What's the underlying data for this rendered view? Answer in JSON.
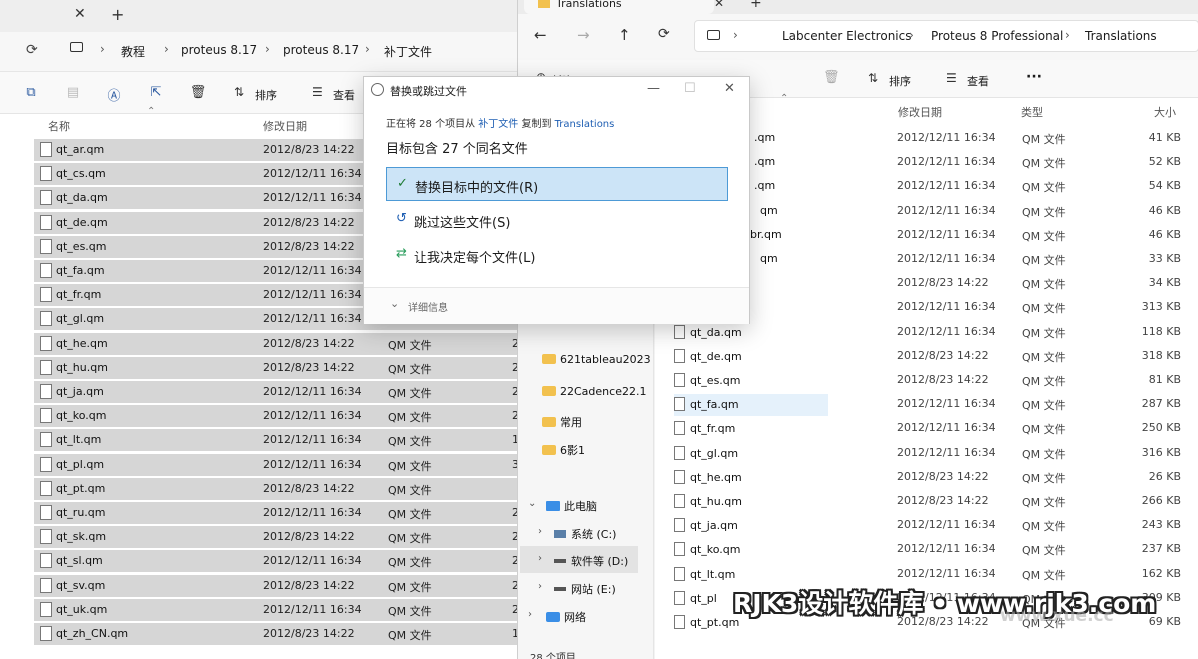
{
  "left": {
    "breadcrumbs": [
      "教程",
      "proteus 8.17",
      "proteus 8.17",
      "补丁文件"
    ],
    "toolbar": {
      "sort_label": "排序",
      "view_label": "查看"
    },
    "columns": {
      "name": "名称",
      "date": "修改日期"
    },
    "rows": [
      {
        "name": "qt_ar.qm",
        "date": "2012/8/23 14:22",
        "type": "",
        "size": ""
      },
      {
        "name": "qt_cs.qm",
        "date": "2012/12/11 16:34",
        "type": "",
        "size": ""
      },
      {
        "name": "qt_da.qm",
        "date": "2012/12/11 16:34",
        "type": "",
        "size": ""
      },
      {
        "name": "qt_de.qm",
        "date": "2012/8/23 14:22",
        "type": "",
        "size": ""
      },
      {
        "name": "qt_es.qm",
        "date": "2012/8/23 14:22",
        "type": "",
        "size": ""
      },
      {
        "name": "qt_fa.qm",
        "date": "2012/12/11 16:34",
        "type": "",
        "size": ""
      },
      {
        "name": "qt_fr.qm",
        "date": "2012/12/11 16:34",
        "type": "",
        "size": ""
      },
      {
        "name": "qt_gl.qm",
        "date": "2012/12/11 16:34",
        "type": "",
        "size": ""
      },
      {
        "name": "qt_he.qm",
        "date": "2012/8/23 14:22",
        "type": "QM 文件",
        "size": "2"
      },
      {
        "name": "qt_hu.qm",
        "date": "2012/8/23 14:22",
        "type": "QM 文件",
        "size": "2"
      },
      {
        "name": "qt_ja.qm",
        "date": "2012/12/11 16:34",
        "type": "QM 文件",
        "size": "2"
      },
      {
        "name": "qt_ko.qm",
        "date": "2012/12/11 16:34",
        "type": "QM 文件",
        "size": "2"
      },
      {
        "name": "qt_lt.qm",
        "date": "2012/12/11 16:34",
        "type": "QM 文件",
        "size": "1"
      },
      {
        "name": "qt_pl.qm",
        "date": "2012/12/11 16:34",
        "type": "QM 文件",
        "size": "3"
      },
      {
        "name": "qt_pt.qm",
        "date": "2012/8/23 14:22",
        "type": "QM 文件",
        "size": ""
      },
      {
        "name": "qt_ru.qm",
        "date": "2012/12/11 16:34",
        "type": "QM 文件",
        "size": "2"
      },
      {
        "name": "qt_sk.qm",
        "date": "2012/8/23 14:22",
        "type": "QM 文件",
        "size": "2"
      },
      {
        "name": "qt_sl.qm",
        "date": "2012/12/11 16:34",
        "type": "QM 文件",
        "size": "2"
      },
      {
        "name": "qt_sv.qm",
        "date": "2012/8/23 14:22",
        "type": "QM 文件",
        "size": "2"
      },
      {
        "name": "qt_uk.qm",
        "date": "2012/12/11 16:34",
        "type": "QM 文件",
        "size": "2"
      },
      {
        "name": "qt_zh_CN.qm",
        "date": "2012/8/23 14:22",
        "type": "QM 文件",
        "size": "1"
      }
    ]
  },
  "right": {
    "tab_title": "Translations",
    "breadcrumbs": [
      "Labcenter Electronics",
      "Proteus 8 Professional",
      "Translations"
    ],
    "toolbar": {
      "new_label": "新建",
      "sort_label": "排序",
      "view_label": "查看",
      "more_label": "···"
    },
    "columns": {
      "date": "修改日期",
      "type": "类型",
      "size": "大小"
    },
    "partial_names": [
      ".qm",
      ".qm",
      ".qm",
      "qm",
      "br.qm",
      "qm"
    ],
    "rows": [
      {
        "name": "",
        "date": "2012/12/11 16:34",
        "type": "QM 文件",
        "size": "41 KB"
      },
      {
        "name": "",
        "date": "2012/12/11 16:34",
        "type": "QM 文件",
        "size": "52 KB"
      },
      {
        "name": "",
        "date": "2012/12/11 16:34",
        "type": "QM 文件",
        "size": "54 KB"
      },
      {
        "name": "",
        "date": "2012/12/11 16:34",
        "type": "QM 文件",
        "size": "46 KB"
      },
      {
        "name": "",
        "date": "2012/12/11 16:34",
        "type": "QM 文件",
        "size": "46 KB"
      },
      {
        "name": "",
        "date": "2012/12/11 16:34",
        "type": "QM 文件",
        "size": "33 KB"
      },
      {
        "name": "",
        "date": "2012/8/23 14:22",
        "type": "QM 文件",
        "size": "34 KB"
      },
      {
        "name": "",
        "date": "2012/12/11 16:34",
        "type": "QM 文件",
        "size": "313 KB"
      },
      {
        "name": "qt_da.qm",
        "date": "2012/12/11 16:34",
        "type": "QM 文件",
        "size": "118 KB"
      },
      {
        "name": "qt_de.qm",
        "date": "2012/8/23 14:22",
        "type": "QM 文件",
        "size": "318 KB"
      },
      {
        "name": "qt_es.qm",
        "date": "2012/8/23 14:22",
        "type": "QM 文件",
        "size": "81 KB"
      },
      {
        "name": "qt_fa.qm",
        "date": "2012/12/11 16:34",
        "type": "QM 文件",
        "size": "287 KB"
      },
      {
        "name": "qt_fr.qm",
        "date": "2012/12/11 16:34",
        "type": "QM 文件",
        "size": "250 KB"
      },
      {
        "name": "qt_gl.qm",
        "date": "2012/12/11 16:34",
        "type": "QM 文件",
        "size": "316 KB"
      },
      {
        "name": "qt_he.qm",
        "date": "2012/8/23 14:22",
        "type": "QM 文件",
        "size": "26 KB"
      },
      {
        "name": "qt_hu.qm",
        "date": "2012/8/23 14:22",
        "type": "QM 文件",
        "size": "266 KB"
      },
      {
        "name": "qt_ja.qm",
        "date": "2012/12/11 16:34",
        "type": "QM 文件",
        "size": "243 KB"
      },
      {
        "name": "qt_ko.qm",
        "date": "2012/12/11 16:34",
        "type": "QM 文件",
        "size": "237 KB"
      },
      {
        "name": "qt_lt.qm",
        "date": "2012/12/11 16:34",
        "type": "QM 文件",
        "size": "162 KB"
      },
      {
        "name": "qt_pl",
        "date": "2012/12/11 16:34",
        "type": "QM 文件",
        "size": "309 KB"
      },
      {
        "name": "qt_pt.qm",
        "date": "2012/8/23 14:22",
        "type": "QM 文件",
        "size": "69 KB"
      }
    ],
    "nav": {
      "folders": [
        "621tableau2023",
        "22Cadence22.1",
        "常用",
        "6影1"
      ],
      "this_pc": "此电脑",
      "drives": [
        "系统 (C:)",
        "软件等 (D:)",
        "网站 (E:)"
      ],
      "network": "网络",
      "status": "28 个项目"
    }
  },
  "dialog": {
    "title": "替换或跳过文件",
    "copy_prefix": "正在将 28 个项目从",
    "source": "补丁文件",
    "copy_mid": "复制到",
    "dest": "Translations",
    "target_info": "目标包含 27 个同名文件",
    "option_replace": "替换目标中的文件(R)",
    "option_skip": "跳过这些文件(S)",
    "option_decide": "让我决定每个文件(L)",
    "details": "详细信息",
    "controls": {
      "minimize": "—",
      "maximize": "☐",
      "close": "✕"
    }
  },
  "watermark": {
    "main": "RJK3设计软件库 • www.rjk3.com",
    "corner": "www.xue.cc"
  }
}
